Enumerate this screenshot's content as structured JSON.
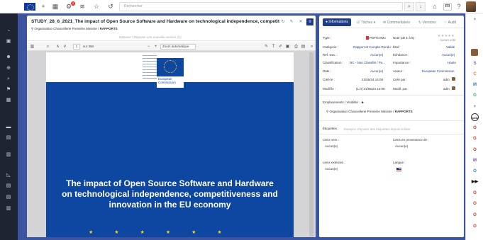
{
  "topbar": {
    "search_placeholder": "Rechercher",
    "notification_count": "0",
    "language": "FR"
  },
  "document": {
    "title": "STUDY_28_6_2021_The impact of Open Source Software and Hardware on technological independence, competitive",
    "path_org": "Organisation Chancellerie Première Ministre",
    "path_sep": " / ",
    "path_folder": "RAPPORTS",
    "drop_hint": "Déposer / Déposer une nouvelle version (C)"
  },
  "pdf_toolbar": {
    "page_current": "1",
    "page_of": "sur 360",
    "zoom": "Zoom automatique"
  },
  "pdf_page": {
    "logo_line1": "European",
    "logo_line2": "Commission",
    "title": "The impact of Open Source Software and Hardware on technological independence, competitiveness and innovation in the EU economy"
  },
  "info": {
    "tabs": {
      "informations": "Informations",
      "taches": "Tâches",
      "commentaires": "Commentaires",
      "versions": "Versions",
      "audit": "Audit"
    },
    "type_label": "Type :",
    "type_value": "PDF/5.0Mo",
    "note_label": "Note (de 1 à 5) :",
    "note_stars": "★★★★★",
    "note_value": "Aucun vote",
    "categorie_label": "Catégorie :",
    "categorie_value": "Rapport et Compte-Rendu",
    "etat_label": "État :",
    "etat_value": "Validé",
    "ref_doc_label": "Ref. Doc. :",
    "ref_doc_value": "Aucun(e)",
    "echeance_label": "Échéance :",
    "echeance_value": "Aucun(e)",
    "classification_label": "Classification :",
    "classification_value": "NC - Non Classifié / Pu...",
    "importance_label": "Importance :",
    "importance_value": "Haute",
    "date_label": "Date :",
    "date_value": "Aucun(e)",
    "auteur_label": "Auteur :",
    "auteur_value": "European Commission",
    "cree_le_label": "Créé le :",
    "cree_le_value": "21/05/24 14:08",
    "cree_par_label": "Créé par :",
    "cree_par_value": "adm",
    "modif_le_label": "Modif le :",
    "modif_le_value": "(1.0) 21/05/24 14:08",
    "modif_par_label": "Modif. par :",
    "modif_par_value": "adm",
    "emplacements_label": "Emplacements / Visibilité :",
    "emplacement_org": "Organisation Chancellerie Première Ministre",
    "emplacement_sep": " / ",
    "emplacement_folder": "RAPPORTS",
    "etiquettes_label": "Étiquettes :",
    "etiquettes_placeholder": "Essayez d'ajouter des étiquettes depuis la liste",
    "liens_vers_label": "Liens vers :",
    "liens_vers_value": "Aucun(e)",
    "liens_prov_label": "Liens en provenance de :",
    "liens_prov_value": "Aucun(e)",
    "liens_ext_label": "Liens externes :",
    "liens_ext_value": "Aucun(e)",
    "langue_label": "Langue :"
  },
  "rightbar": {
    "items": [
      "S",
      "C",
      "M",
      "G",
      "O",
      "O",
      "G",
      "M",
      "O",
      "O",
      "O",
      "O",
      "O"
    ]
  },
  "colors": {
    "accent": "#1f3b86",
    "sidebar": "#1f2433",
    "background": "#3d54a0",
    "pdf_blue": "#0e47a1"
  }
}
